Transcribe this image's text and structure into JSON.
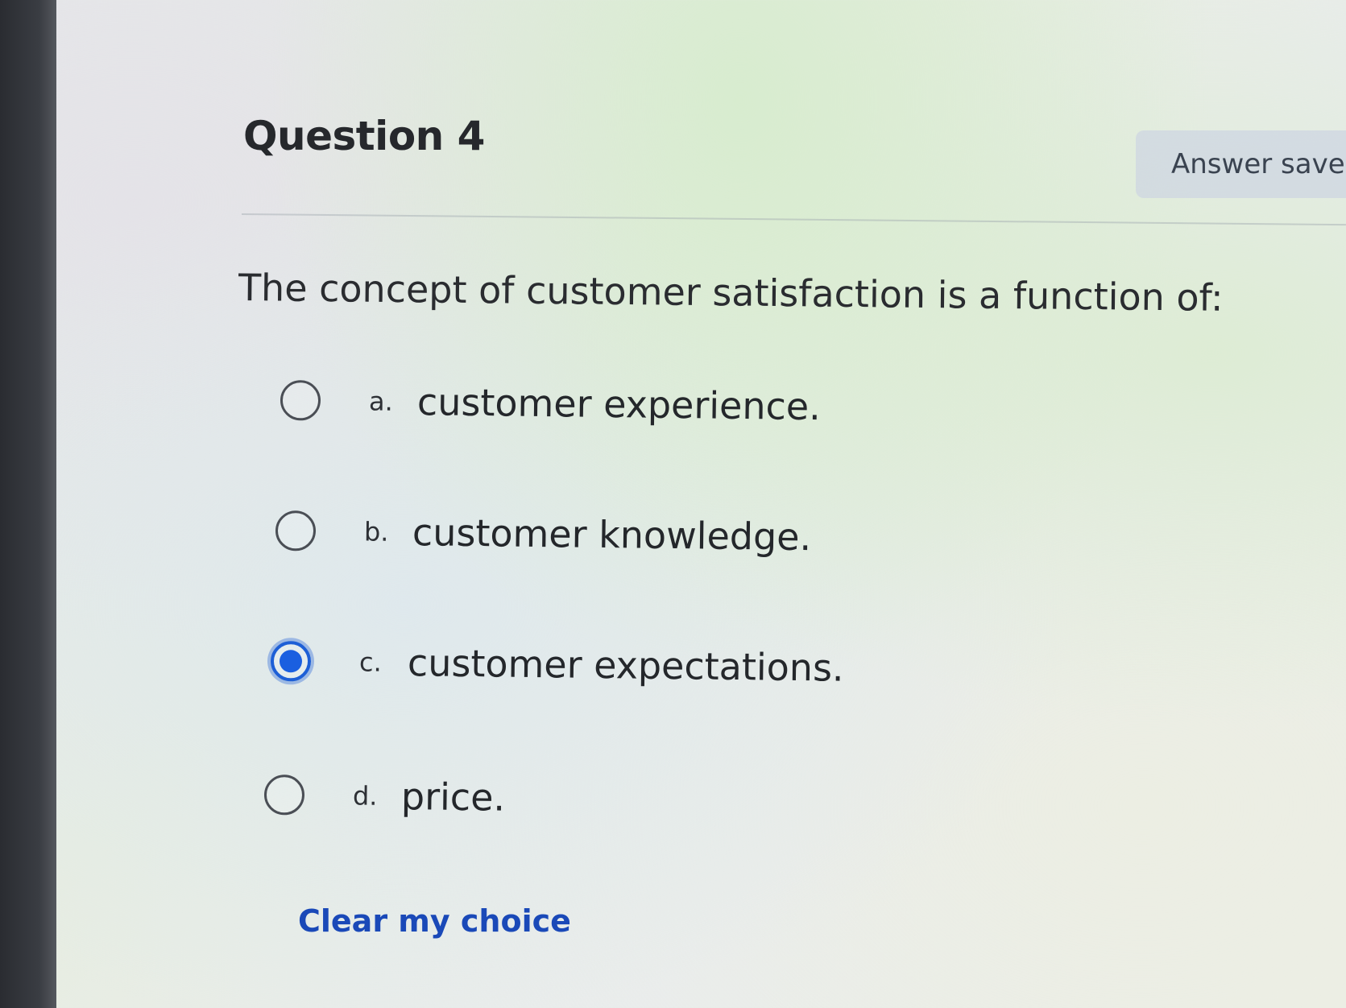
{
  "question": {
    "title": "Question 4",
    "status": "Answer save",
    "text": "The concept of customer satisfaction is a function of:"
  },
  "options": [
    {
      "letter": "a.",
      "text": "customer experience.",
      "selected": false
    },
    {
      "letter": "b.",
      "text": "customer knowledge.",
      "selected": false
    },
    {
      "letter": "c.",
      "text": "customer expectations.",
      "selected": true
    },
    {
      "letter": "d.",
      "text": "price.",
      "selected": false
    }
  ],
  "actions": {
    "clear_label": "Clear my choice"
  },
  "colors": {
    "accent": "#1a5fe0",
    "link": "#1a49b8",
    "status_bg": "#ced6e2"
  }
}
